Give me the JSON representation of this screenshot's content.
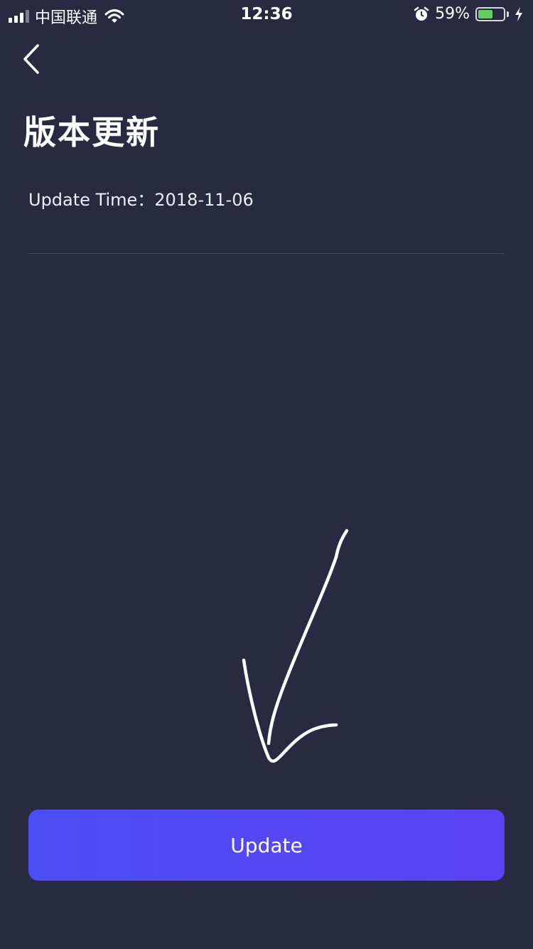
{
  "status_bar": {
    "carrier": "中国联通",
    "time": "12:36",
    "battery_percent": "59%",
    "battery_level": 0.59,
    "icons": [
      "signal-icon",
      "wifi-icon",
      "alarm-icon",
      "battery-icon",
      "charging-icon"
    ]
  },
  "header": {
    "back_icon": "chevron-left-icon",
    "title": "版本更新"
  },
  "content": {
    "update_time_label": "Update Time：",
    "update_time_value": "2018-11-06"
  },
  "actions": {
    "update_label": "Update"
  },
  "colors": {
    "background": "#282a42",
    "button_gradient_start": "#4b4ef4",
    "button_gradient_end": "#5c42f4",
    "divider": "#45485f",
    "battery_fill": "#5fd05c"
  }
}
